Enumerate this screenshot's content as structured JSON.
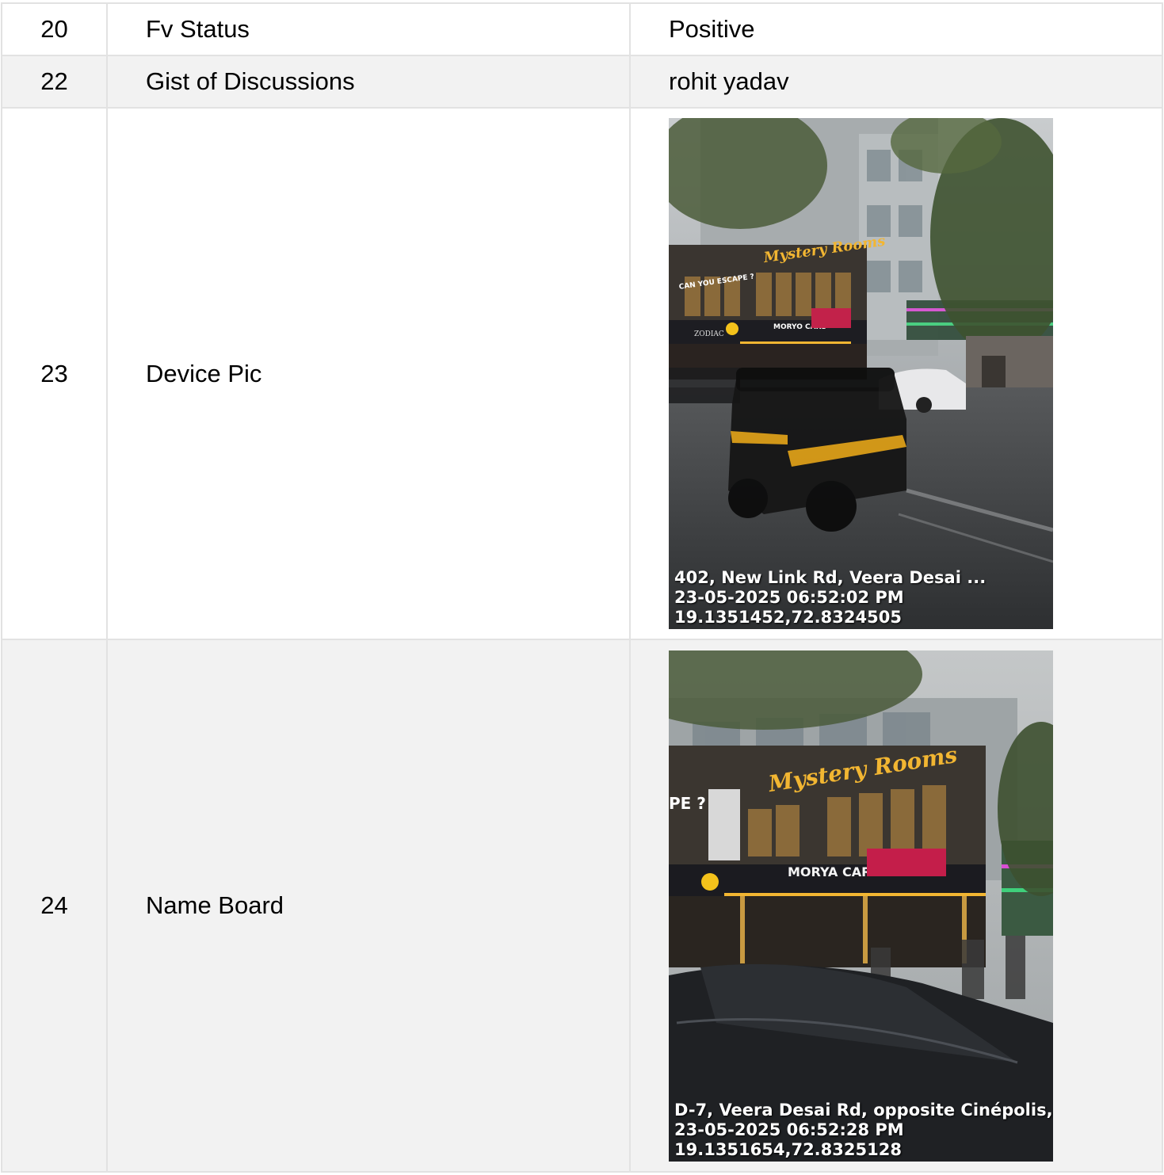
{
  "rows": [
    {
      "num": "20",
      "label": "Fv Status",
      "value": "Positive"
    },
    {
      "num": "22",
      "label": "Gist of Discussions",
      "value": "rohit yadav"
    },
    {
      "num": "23",
      "label": "Device Pic",
      "photo": {
        "scene_signs": [
          "Mystery Rooms",
          "CAN YOU ESCAPE ?",
          "ZODIAC",
          "MORYO CARS"
        ],
        "stamp": [
          "402, New Link Rd, Veera Desai ...",
          "23-05-2025 06:52:02 PM",
          "19.1351452,72.8324505"
        ]
      }
    },
    {
      "num": "24",
      "label": "Name Board",
      "photo": {
        "scene_signs": [
          "Mystery Rooms",
          "MORYA CARS",
          "PE ?"
        ],
        "stamp": [
          "D-7, Veera Desai Rd, opposite Cinépolis, ...",
          "23-05-2025 06:52:28 PM",
          "19.1351654,72.8325128"
        ]
      }
    }
  ]
}
